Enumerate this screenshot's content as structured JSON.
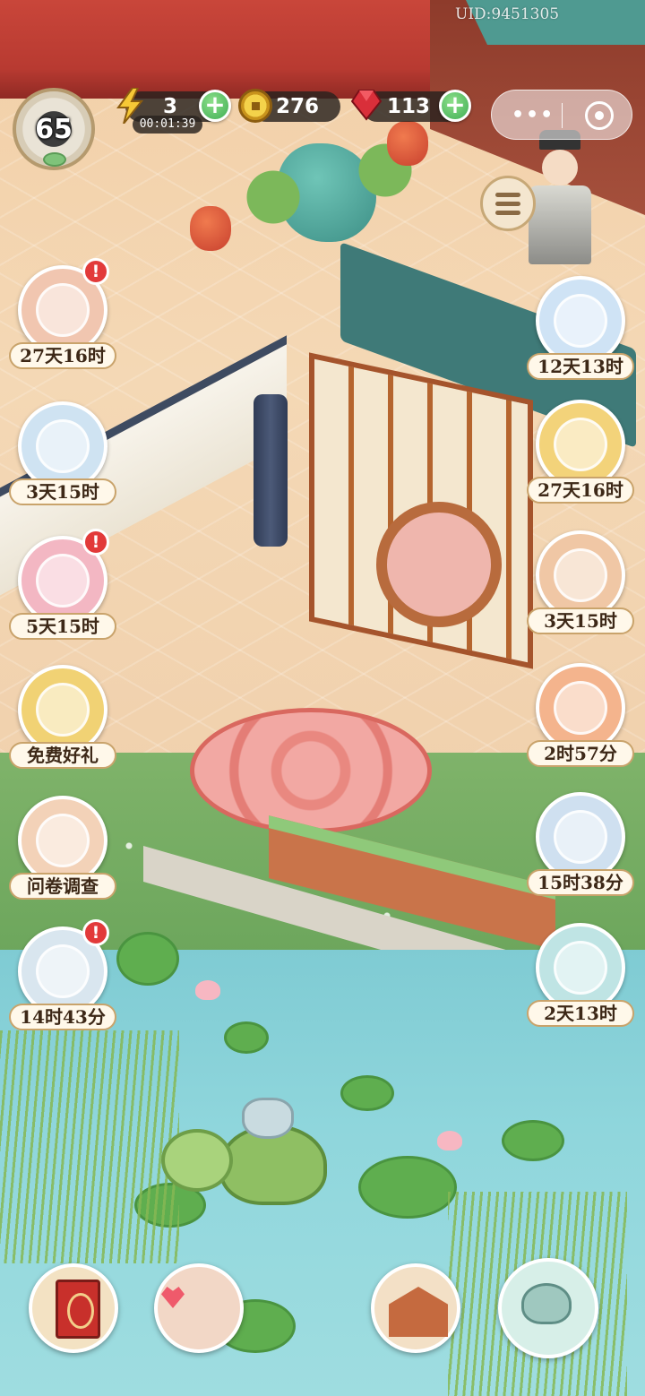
{
  "uid": "UID:9451305",
  "level": "65",
  "resources": {
    "energy": {
      "value": "3",
      "timer": "00:01:39",
      "plus": "+"
    },
    "coins": {
      "value": "276"
    },
    "gems": {
      "value": "113",
      "plus": "+"
    }
  },
  "capsule": {
    "more": "•••"
  },
  "left_events": [
    {
      "label": "27天16时",
      "alert": "!",
      "color": "#f1c6b0"
    },
    {
      "label": "3天15时",
      "alert": "",
      "color": "#cfe3f2"
    },
    {
      "label": "5天15时",
      "alert": "!",
      "color": "#f3b7c3"
    },
    {
      "label": "免费好礼",
      "alert": "",
      "color": "#f1d274"
    },
    {
      "label": "问卷调查",
      "alert": "",
      "color": "#f3d2b8"
    },
    {
      "label": "14时43分",
      "alert": "!",
      "color": "#d9e6ef"
    }
  ],
  "right_events": [
    {
      "label": "12天13时",
      "color": "#cfe3f5"
    },
    {
      "label": "27天16时",
      "color": "#f3d37a"
    },
    {
      "label": "3天15时",
      "color": "#f0c7a5"
    },
    {
      "label": "2时57分",
      "color": "#f4b48d"
    },
    {
      "label": "15时38分",
      "color": "#cfe0f0"
    },
    {
      "label": "2天13时",
      "color": "#bfe4e4"
    }
  ],
  "colors": {
    "plus_button": "#3fae54",
    "alert": "#e23a3a",
    "label_border": "#c9a36b"
  },
  "icons": {
    "energy": "lightning-bolt-icon",
    "coins": "gold-coin-icon",
    "gems": "red-gem-icon",
    "menu": "list-icon",
    "capsule_more": "more-dots-icon",
    "capsule_close": "target-close-icon"
  }
}
